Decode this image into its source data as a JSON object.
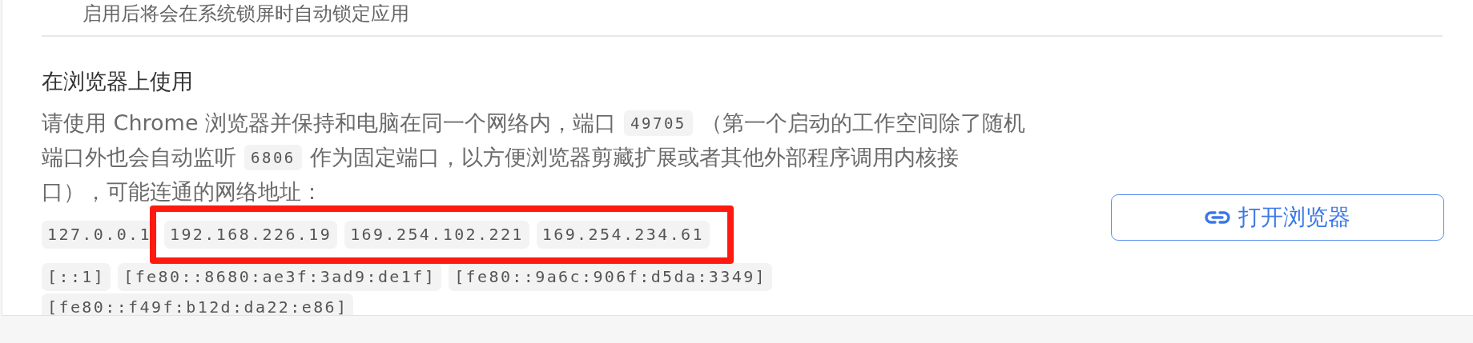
{
  "previous_setting": {
    "description": "启用后将会在系统锁屏时自动锁定应用"
  },
  "section": {
    "title": "在浏览器上使用",
    "description_lines": [
      [
        {
          "kind": "text",
          "text": "请使用 Chrome 浏览器并保持和电脑在同一个网络内，端口"
        },
        {
          "kind": "code",
          "text": "49705"
        },
        {
          "kind": "text",
          "text": "（第一个启动的工作空间除了随机"
        }
      ],
      [
        {
          "kind": "text",
          "text": "端口外也会自动监听"
        },
        {
          "kind": "code",
          "text": "6806"
        },
        {
          "kind": "text",
          "text": "作为固定端口，以方便浏览器剪藏扩展或者其他外部程序调用内核接"
        }
      ],
      [
        {
          "kind": "text",
          "text": "口），可能连通的网络地址："
        }
      ]
    ],
    "address_groups": [
      [
        {
          "kind": "plain",
          "addresses": [
            "127.0.0.1"
          ]
        },
        {
          "kind": "annotated",
          "addresses": [
            "192.168.226.19",
            "169.254.102.221",
            "169.254.234.61"
          ]
        }
      ],
      [
        {
          "kind": "plain",
          "addresses": [
            "[::1]",
            "[fe80::8680:ae3f:3ad9:de1f]",
            "[fe80::9a6c:906f:d5da:3349]",
            "[fe80::f49f:b12d:da22:e86]"
          ]
        }
      ]
    ],
    "button": {
      "label": "打开浏览器"
    }
  }
}
